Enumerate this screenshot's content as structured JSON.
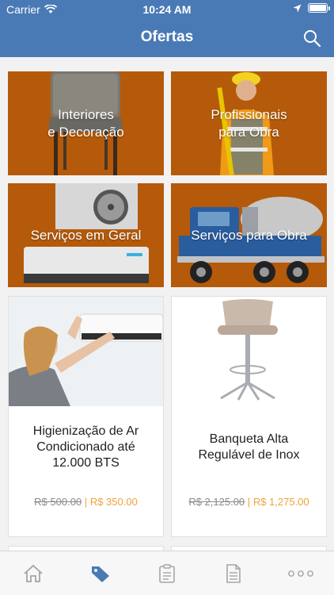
{
  "status_bar": {
    "carrier": "Carrier",
    "time": "10:24 AM"
  },
  "header": {
    "title": "Ofertas"
  },
  "categories": [
    {
      "label": "Interiores\ne Decoração"
    },
    {
      "label": "Profissionais\npara Obra"
    },
    {
      "label": "Serviços em Geral"
    },
    {
      "label": "Serviços para Obra"
    }
  ],
  "offers": [
    {
      "name": "Higienização de Ar Condicionado até 12.000 BTS",
      "old_price": "R$ 500.00",
      "separator": "|",
      "new_price": "R$ 350.00"
    },
    {
      "name": "Banqueta Alta Regulável de Inox",
      "old_price": "R$ 2,125.00",
      "separator": "|",
      "new_price": "R$ 1,275.00"
    }
  ],
  "tabs": [
    {
      "icon": "home-icon",
      "active": false
    },
    {
      "icon": "tag-icon",
      "active": true
    },
    {
      "icon": "clipboard-icon",
      "active": false
    },
    {
      "icon": "document-icon",
      "active": false
    },
    {
      "icon": "more-icon",
      "active": false
    }
  ],
  "colors": {
    "header": "#4a7ab5",
    "category_bg": "#b45a0a",
    "price_accent": "#f0a23a",
    "tab_active": "#4a7ab5"
  }
}
